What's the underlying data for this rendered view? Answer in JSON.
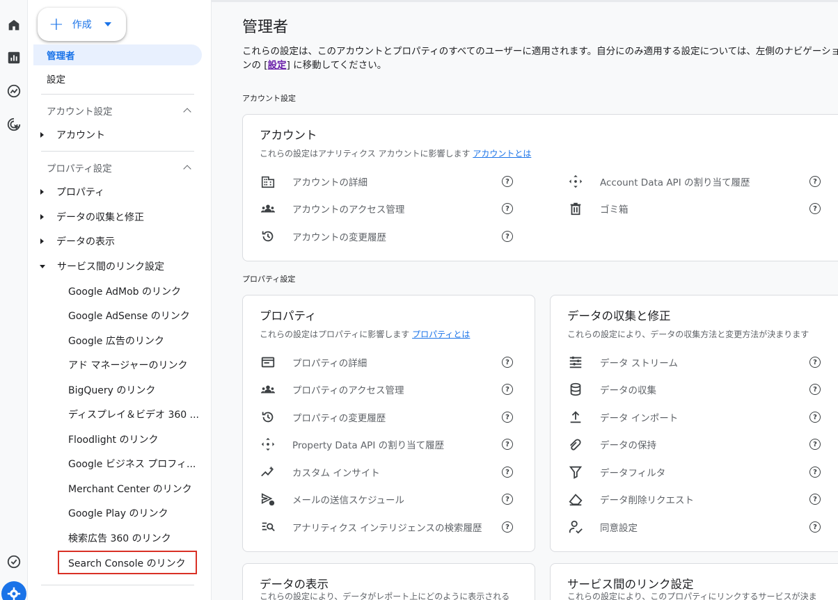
{
  "create_button": {
    "label": "作成"
  },
  "sidebar": {
    "admin_label": "管理者",
    "settings_label": "設定",
    "account_section": "アカウント設定",
    "account_item": "アカウント",
    "property_section": "プロパティ設定",
    "tree_items": [
      "プロパティ",
      "データの収集と修正",
      "データの表示",
      "サービス間のリンク設定"
    ],
    "link_items": [
      "Google AdMob のリンク",
      "Google AdSense のリンク",
      "Google 広告のリンク",
      "アド マネージャーのリンク",
      "BigQuery のリンク",
      "ディスプレイ＆ビデオ 360 ...",
      "Floodlight のリンク",
      "Google ビジネス プロフィ...",
      "Merchant Center のリンク",
      "Google Play のリンク",
      "検索広告 360 のリンク",
      "Search Console のリンク"
    ]
  },
  "main": {
    "title": "管理者",
    "desc_before": "これらの設定は、このアカウントとプロパティのすべてのユーザーに適用されます。自分にのみ適用する設定については、左側のナビゲーションの [",
    "desc_link": "設定",
    "desc_after": "] に移動してください。",
    "account_section_label": "アカウント設定",
    "property_section_label": "プロパティ設定",
    "account_card": {
      "title": "アカウント",
      "subtitle": "これらの設定はアナリティクス アカウントに影響します ",
      "subtitle_link": "アカウントとは",
      "left_rows": [
        "アカウントの詳細",
        "アカウントのアクセス管理",
        "アカウントの変更履歴"
      ],
      "right_rows": [
        "Account Data API の割り当て履歴",
        "ゴミ箱"
      ]
    },
    "property_card": {
      "title": "プロパティ",
      "subtitle": "これらの設定はプロパティに影響します ",
      "subtitle_link": "プロパティとは",
      "rows": [
        "プロパティの詳細",
        "プロパティのアクセス管理",
        "プロパティの変更履歴",
        "Property Data API の割り当て履歴",
        "カスタム インサイト",
        "メールの送信スケジュール",
        "アナリティクス インテリジェンスの検索履歴"
      ]
    },
    "collection_card": {
      "title": "データの収集と修正",
      "subtitle": "これらの設定により、データの収集方法と変更方法が決まります",
      "rows": [
        "データ ストリーム",
        "データの収集",
        "データ インポート",
        "データの保持",
        "データフィルタ",
        "データ削除リクエスト",
        "同意設定"
      ]
    },
    "display_card": {
      "title": "データの表示",
      "subtitle": "これらの設定により、データがレポート上にどのように表示される"
    },
    "linking_card": {
      "title": "サービス間のリンク設定",
      "subtitle": "これらの設定により、このプロパティにリンクするサービスが決ま"
    }
  },
  "colors": {
    "accent": "#1a73e8",
    "highlight": "#d93025",
    "nav_active_bg": "#e8f0fe"
  }
}
